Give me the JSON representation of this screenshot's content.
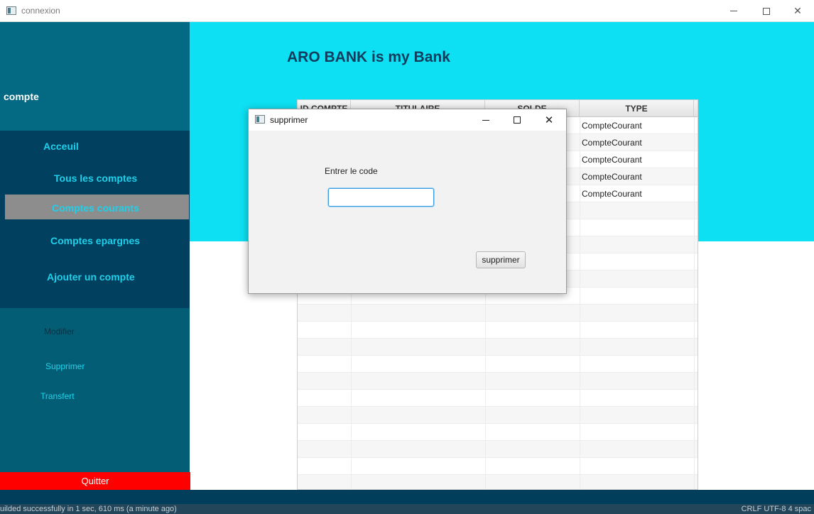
{
  "window": {
    "title": "connexion",
    "minimize_glyph": "—",
    "maximize_glyph": "☐",
    "close_glyph": "✕"
  },
  "sidebar": {
    "header": "compte",
    "nav": [
      {
        "label": "Acceuil"
      },
      {
        "label": "Tous les comptes"
      },
      {
        "label": "Comptes courants",
        "selected": true
      },
      {
        "label": "Comptes epargnes"
      },
      {
        "label": "Ajouter un compte"
      }
    ],
    "actions": [
      {
        "label": "Modifier"
      },
      {
        "label": "Supprimer"
      },
      {
        "label": "Transfert"
      }
    ],
    "quit_label": "Quitter"
  },
  "main": {
    "heading": "ARO BANK is my Bank",
    "table": {
      "columns": [
        "ID COMPTE",
        "TITULAIRE",
        "SOLDE",
        "TYPE"
      ],
      "rows": [
        {
          "type": "CompteCourant"
        },
        {
          "type": "CompteCourant"
        },
        {
          "type": "CompteCourant"
        },
        {
          "type": "CompteCourant"
        },
        {
          "type": "CompteCourant"
        }
      ]
    }
  },
  "dialog": {
    "title": "supprimer",
    "label": "Entrer le code",
    "input_value": "",
    "submit_label": "supprimer"
  },
  "statusbar": {
    "message": "uilded successfully in 1 sec, 610 ms (a minute ago)",
    "right": "CRLF   UTF-8   4 spac"
  },
  "colors": {
    "sidebar": "#035d75",
    "sidebar_nav": "#01405f",
    "accent_text": "#1fd0ea",
    "banner": "#0de0f2",
    "heading": "#103d5e",
    "quit": "#ff0000",
    "selected_nav": "#8d8d8d"
  },
  "icons": {
    "app": "app-window-icon",
    "minimize": "minimize-icon",
    "maximize": "maximize-icon",
    "close": "close-icon"
  }
}
